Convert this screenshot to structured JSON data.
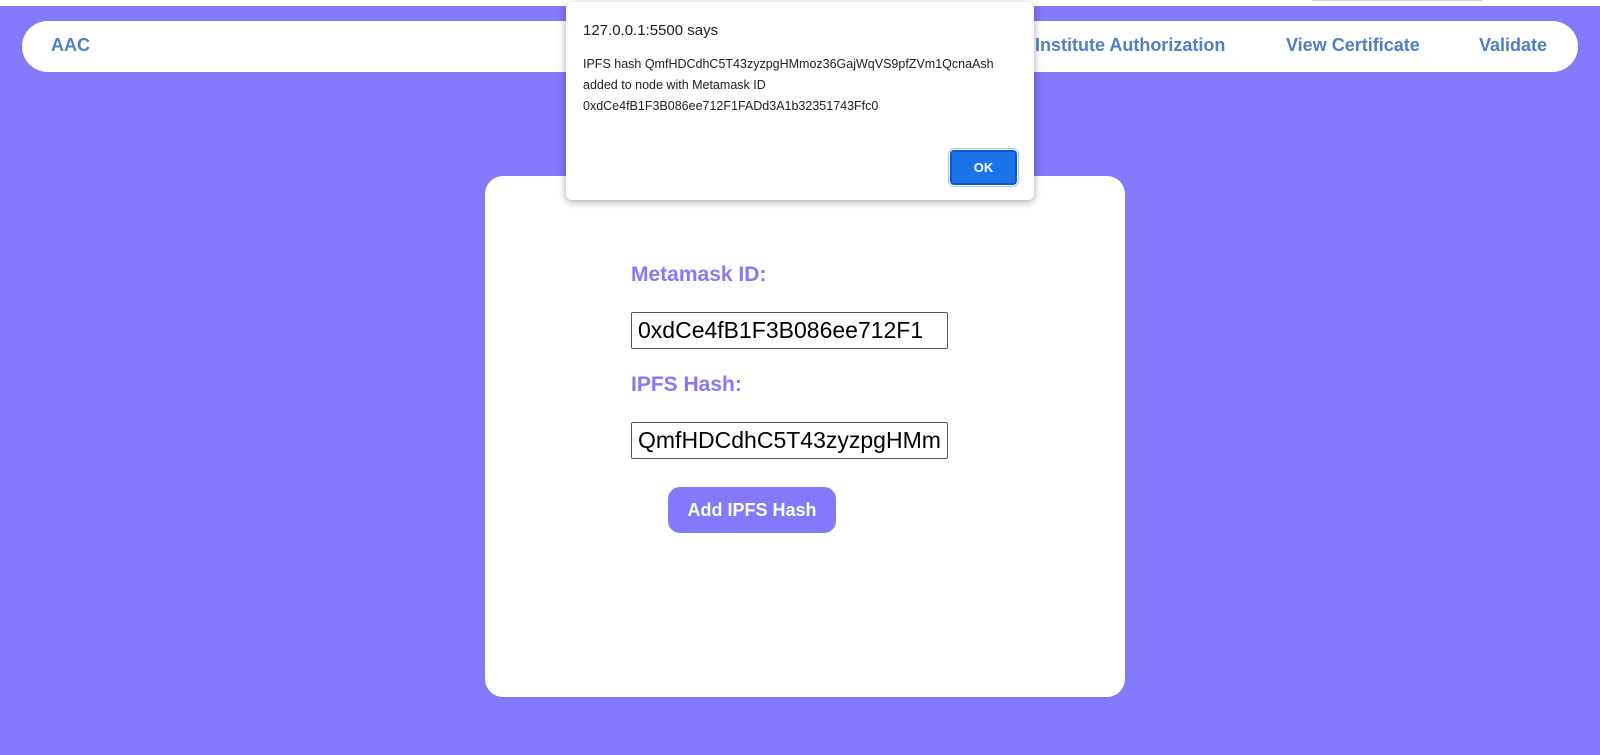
{
  "navbar": {
    "brand": "AAC",
    "links": [
      "Institute Authorization",
      "View Certificate",
      "Validate"
    ]
  },
  "form": {
    "metamask_label": "Metamask ID:",
    "metamask_value": "0xdCe4fB1F3B086ee712F1",
    "ipfs_label": "IPFS Hash:",
    "ipfs_value": "QmfHDCdhC5T43zyzpgHMmoz36GajWqVS9pfZVm1QcnaAsh",
    "add_button": "Add IPFS Hash"
  },
  "dialog": {
    "title": "127.0.0.1:5500 says",
    "message_lines": [
      "IPFS hash QmfHDCdhC5T43zyzpgHMmoz36GajWqVS9pfZVm1QcnaAsh",
      "added to node with Metamask ID",
      "0xdCe4fB1F3B086ee712F1FADd3A1b32351743Ffc0"
    ],
    "ok_label": "OK"
  },
  "colors": {
    "background": "#8478fb",
    "nav_link": "#4f7fc4",
    "label": "#8478fb",
    "ok_button": "#1a73e8"
  }
}
